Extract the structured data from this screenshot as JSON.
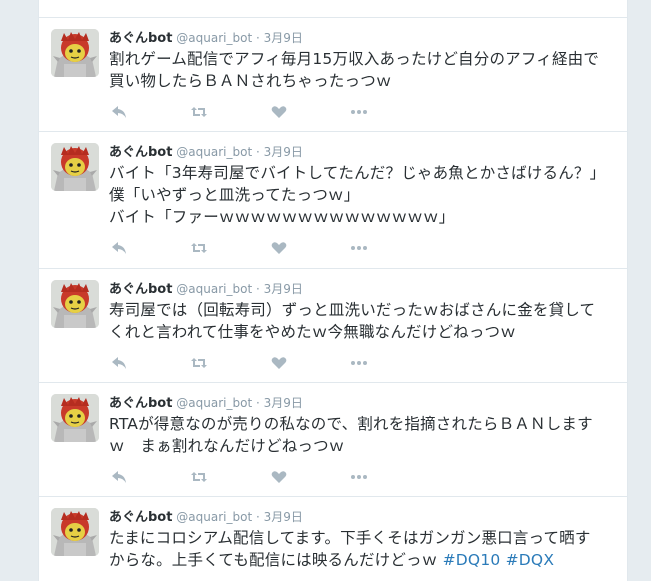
{
  "tweets": [
    {
      "name": "あぐんbot",
      "handle": "@aquari_bot",
      "sep": "·",
      "date": "3月9日",
      "lines": [
        "割れゲーム配信でアフィ毎月15万収入あったけど自分のアフィ経由で",
        "買い物したらＢＡＮされちゃったっつｗ"
      ]
    },
    {
      "name": "あぐんbot",
      "handle": "@aquari_bot",
      "sep": "·",
      "date": "3月9日",
      "lines": [
        "バイト「3年寿司屋でバイトしてたんだ？じゃあ魚とかさばけるん？」",
        "僕「いやずっと皿洗ってたっつｗ」",
        "バイト「ファーｗｗｗｗｗｗｗｗｗｗｗｗｗｗ」"
      ]
    },
    {
      "name": "あぐんbot",
      "handle": "@aquari_bot",
      "sep": "·",
      "date": "3月9日",
      "lines": [
        "寿司屋では（回転寿司）ずっと皿洗いだったｗおばさんに金を貸して",
        "くれと言われて仕事をやめたｗ今無職なんだけどねっつｗ"
      ]
    },
    {
      "name": "あぐんbot",
      "handle": "@aquari_bot",
      "sep": "·",
      "date": "3月9日",
      "lines": [
        "RTAが得意なのが売りの私なので、割れを指摘されたらＢＡＮします",
        "ｗ　まぁ割れなんだけどねっつｗ"
      ]
    },
    {
      "name": "あぐんbot",
      "handle": "@aquari_bot",
      "sep": "·",
      "date": "3月9日",
      "lines": [
        "たまにコロシアム配信してます。下手くそはガンガン悪口言って晒す",
        "からな。上手くても配信には映るんだけどっｗ "
      ],
      "hashtags": [
        "#DQ10",
        "#DQX"
      ]
    }
  ],
  "icons": {
    "reply": "reply-icon",
    "retweet": "retweet-icon",
    "like": "heart-icon",
    "more": "more-icon"
  },
  "colors": {
    "background": "#e6ecf0",
    "card": "#ffffff",
    "border": "#e1e8ed",
    "name": "#292f33",
    "meta": "#8899a6",
    "text": "#292f33",
    "hashtag": "#2b7bb9",
    "action_icon": "#aab8c2"
  }
}
